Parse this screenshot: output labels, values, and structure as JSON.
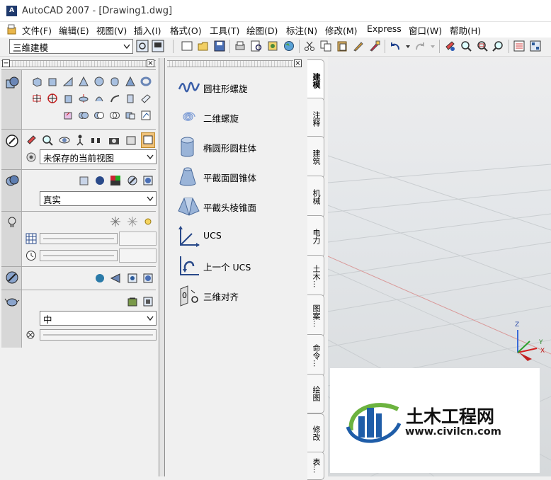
{
  "window": {
    "title": "AutoCAD 2007 - [Drawing1.dwg]",
    "app_icon_text": "A"
  },
  "menubar": [
    "文件(F)",
    "编辑(E)",
    "视图(V)",
    "插入(I)",
    "格式(O)",
    "工具(T)",
    "绘图(D)",
    "标注(N)",
    "修改(M)",
    "Express",
    "窗口(W)",
    "帮助(H)"
  ],
  "toolbar": {
    "workspace": "三维建模"
  },
  "dashboard": {
    "view_combo": "未保存的当前视图",
    "visual_style_combo": "真实",
    "material_combo": "中"
  },
  "tool_palette": {
    "items": [
      {
        "label": "圆柱形螺旋",
        "icon": "cylindrical-helix-icon"
      },
      {
        "label": "二维螺旋",
        "icon": "2d-spiral-icon"
      },
      {
        "label": "椭圆形圆柱体",
        "icon": "elliptical-cylinder-icon"
      },
      {
        "label": "平截面圆锥体",
        "icon": "frustum-cone-icon"
      },
      {
        "label": "平截头棱锥面",
        "icon": "frustum-pyramid-icon"
      },
      {
        "label": "UCS",
        "icon": "ucs-icon"
      },
      {
        "label": "上一个 UCS",
        "icon": "ucs-previous-icon"
      },
      {
        "label": "三维对齐",
        "icon": "3d-align-icon"
      }
    ],
    "tabs": [
      "建模",
      "注释",
      "建筑",
      "机械",
      "电力",
      "土木...",
      "图案...",
      "命令...",
      "绘图",
      "修改",
      "表..."
    ],
    "active_tab": "建模"
  },
  "viewport": {
    "axis_z": "Z",
    "axis_y": "Y",
    "axis_x": "X"
  },
  "watermark": {
    "main": "土木工程网",
    "url": "www.civilcn.com"
  }
}
